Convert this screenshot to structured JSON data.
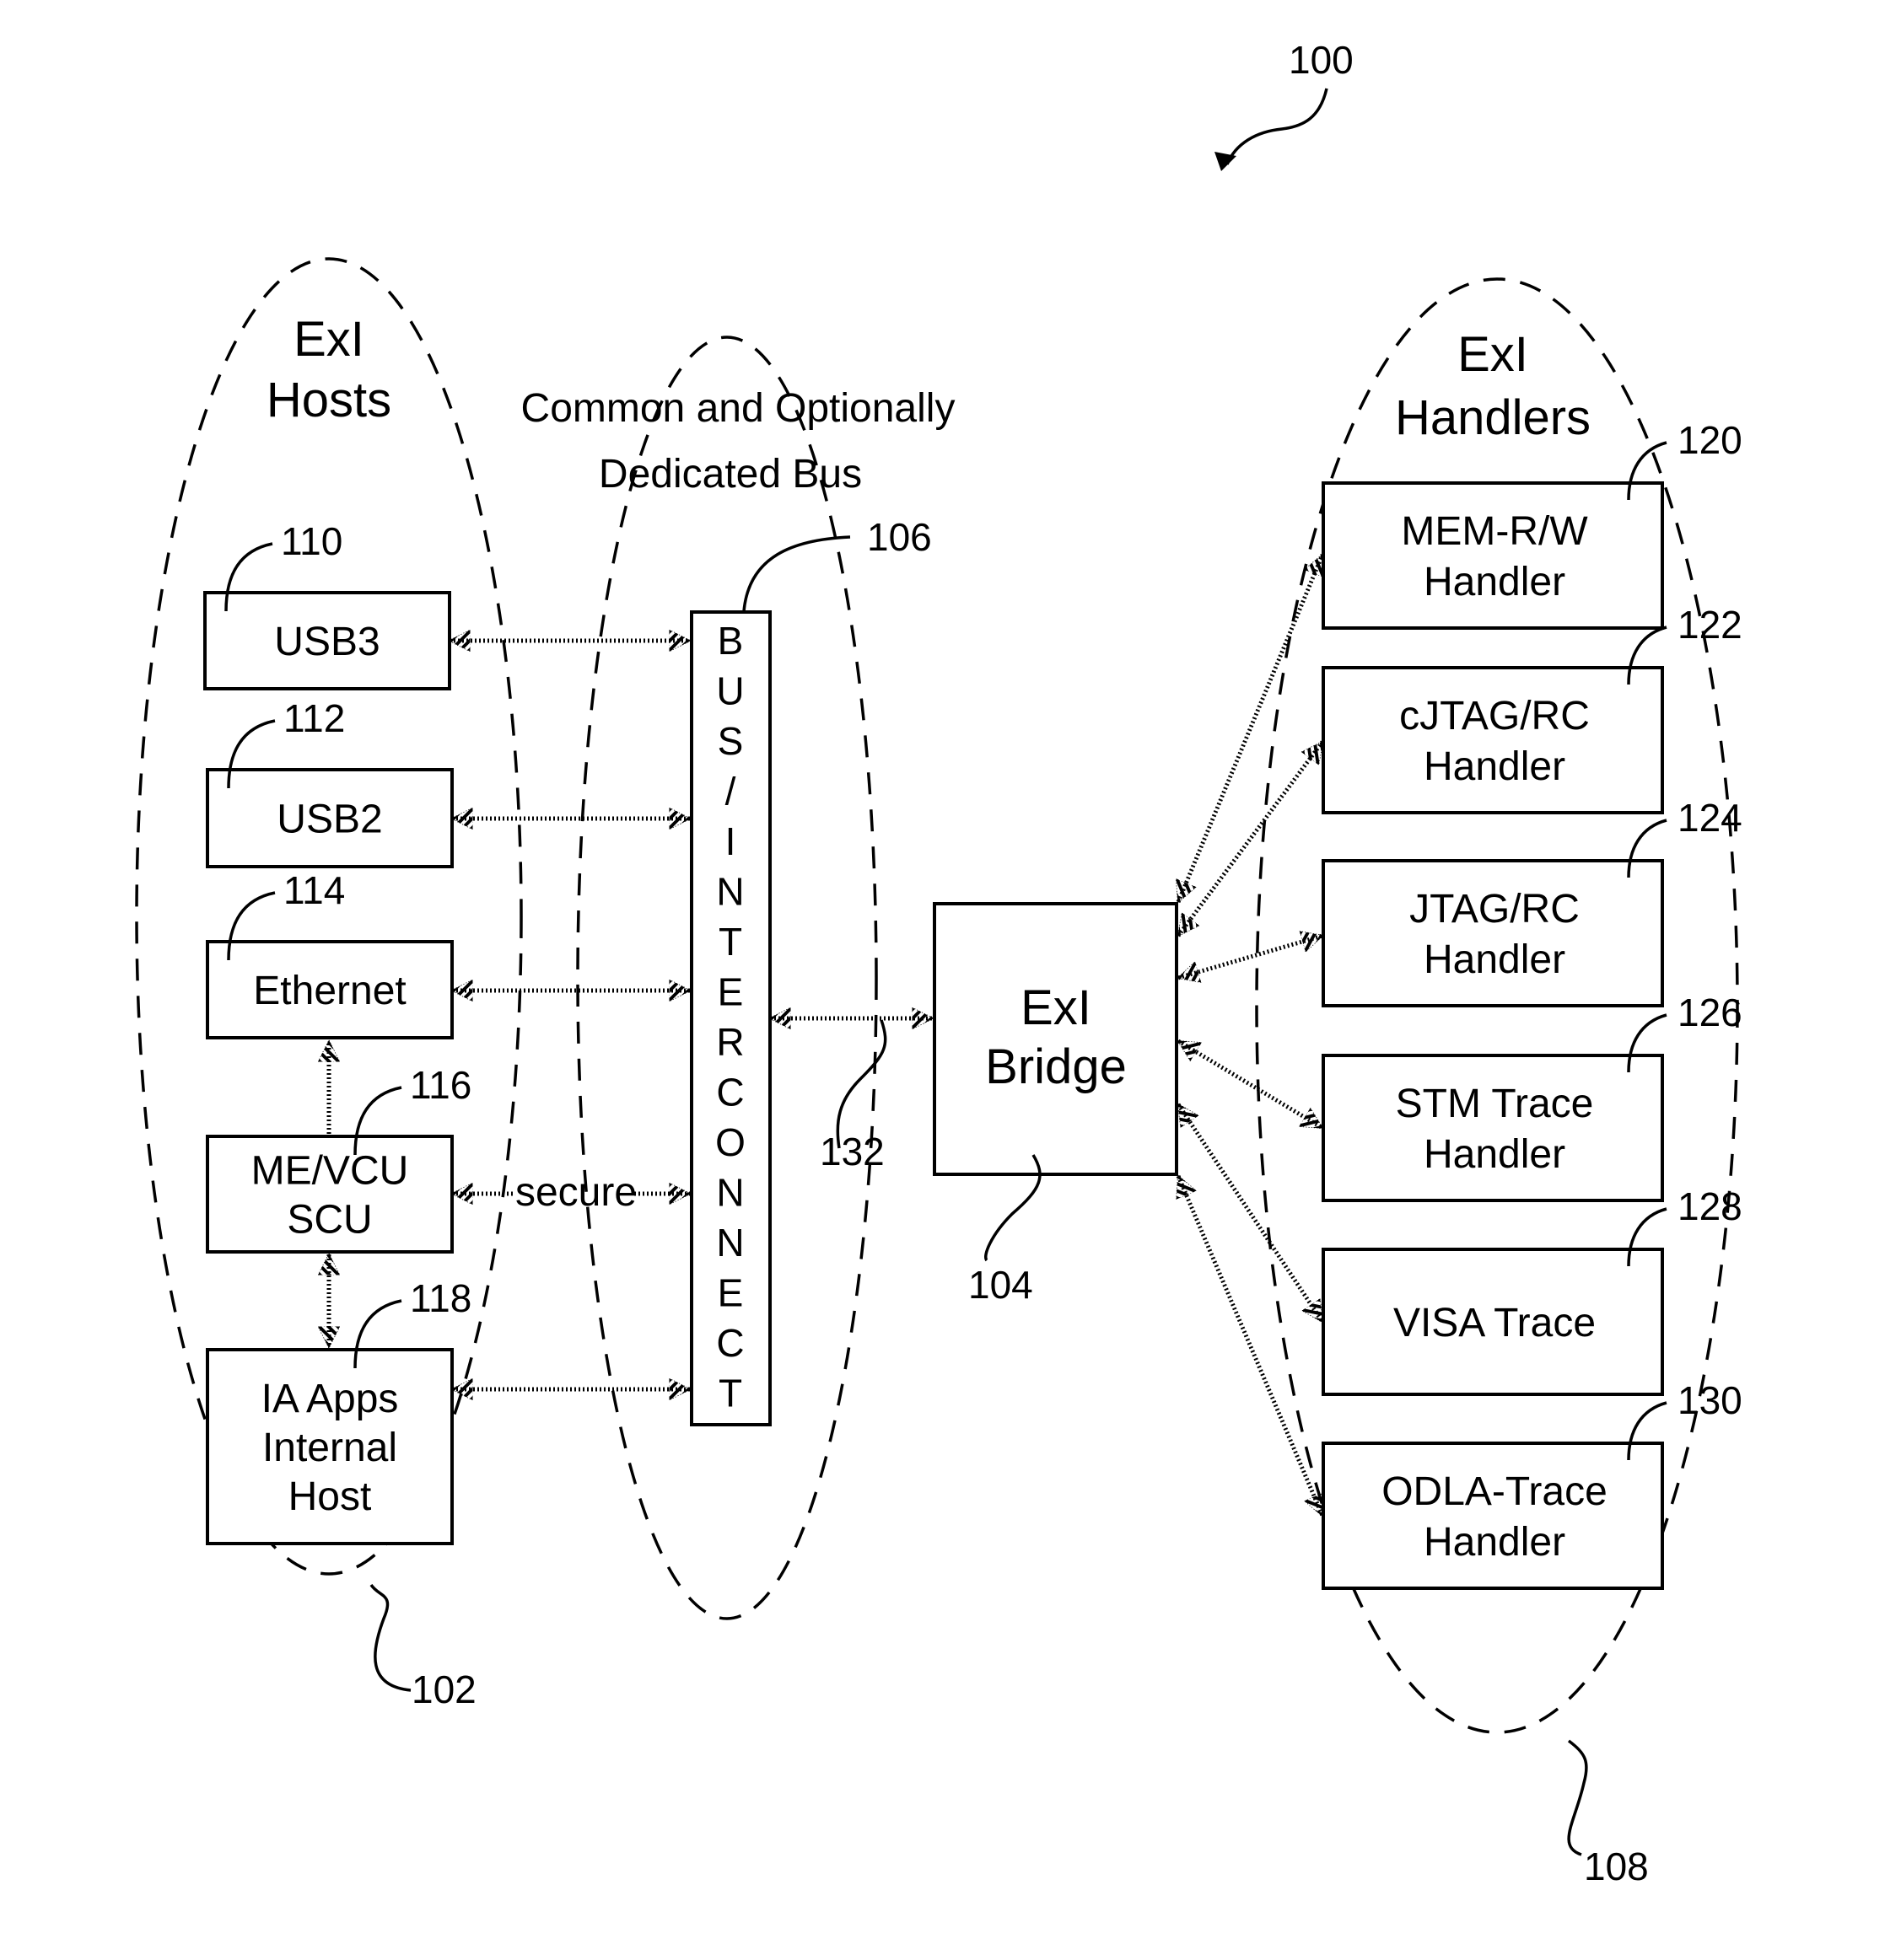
{
  "figure": {
    "ref": "100",
    "colors": {
      "ink": "#000000",
      "background": "#ffffff"
    }
  },
  "hosts_group": {
    "title_line1": "ExI",
    "title_line2": "Hosts",
    "ref": "102",
    "boxes": [
      {
        "ref": "110",
        "lines": [
          "USB3"
        ]
      },
      {
        "ref": "112",
        "lines": [
          "USB2"
        ]
      },
      {
        "ref": "114",
        "lines": [
          "Ethernet"
        ]
      },
      {
        "ref": "116",
        "lines": [
          "ME/VCU",
          "SCU"
        ]
      },
      {
        "ref": "118",
        "lines": [
          "IA Apps",
          "Internal",
          "Host"
        ]
      }
    ],
    "secure_label": "secure"
  },
  "bus_group": {
    "title_line1": "Common and Optionally",
    "title_line2": "Dedicated Bus",
    "ref": "106",
    "bus_letters": [
      "B",
      "U",
      "S",
      "/",
      "I",
      "N",
      "T",
      "E",
      "R",
      "C",
      "O",
      "N",
      "N",
      "E",
      "C",
      "T"
    ]
  },
  "bridge": {
    "lines": [
      "ExI",
      "Bridge"
    ],
    "ref": "104",
    "link_ref": "132"
  },
  "handlers_group": {
    "title_line1": "ExI",
    "title_line2": "Handlers",
    "ref": "108",
    "boxes": [
      {
        "ref": "120",
        "lines": [
          "MEM-R/W",
          "Handler"
        ]
      },
      {
        "ref": "122",
        "lines": [
          "cJTAG/RC",
          "Handler"
        ]
      },
      {
        "ref": "124",
        "lines": [
          "JTAG/RC",
          "Handler"
        ]
      },
      {
        "ref": "126",
        "lines": [
          "STM Trace",
          "Handler"
        ]
      },
      {
        "ref": "128",
        "lines": [
          "VISA Trace"
        ]
      },
      {
        "ref": "130",
        "lines": [
          "ODLA-Trace",
          "Handler"
        ]
      }
    ]
  }
}
